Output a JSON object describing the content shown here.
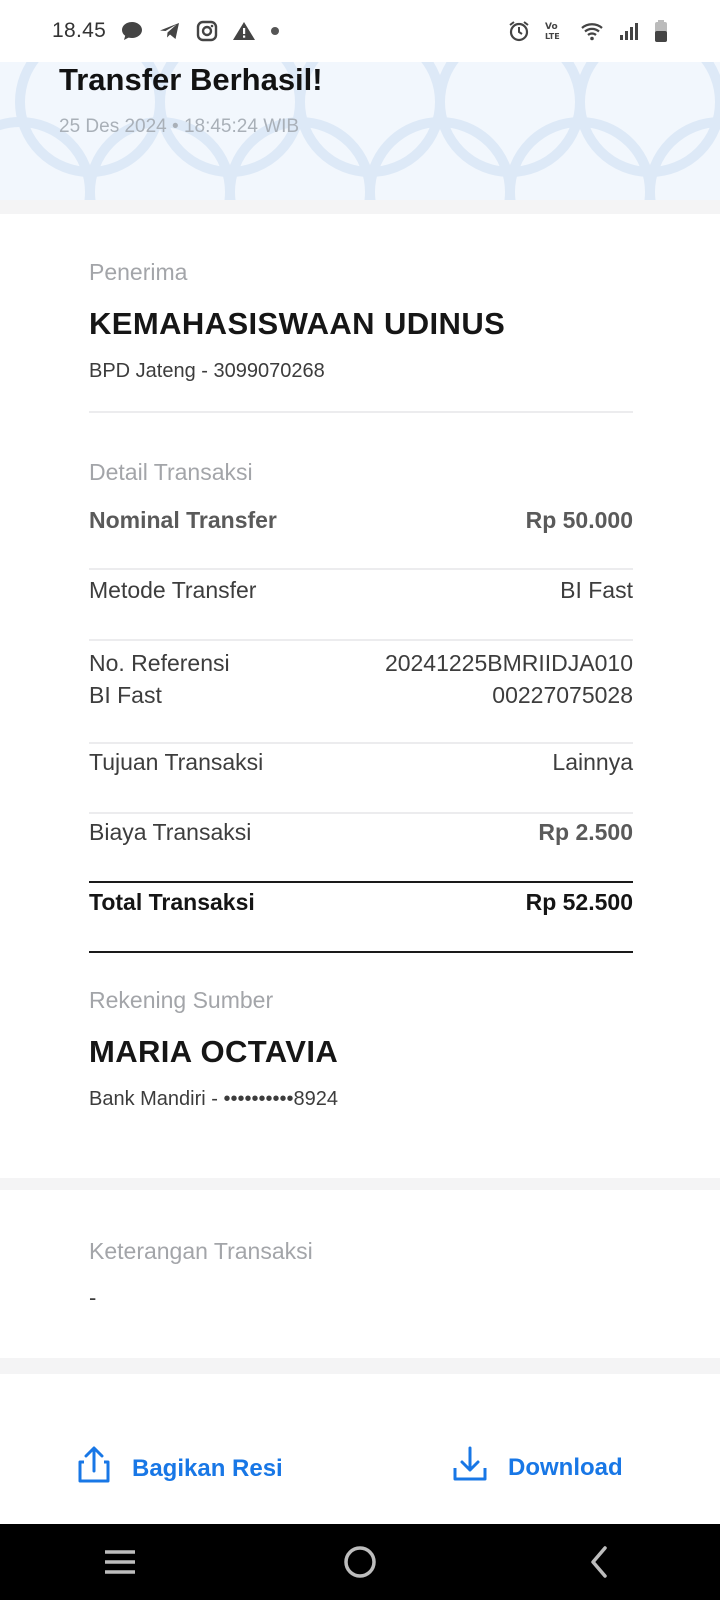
{
  "status_bar": {
    "time": "18.45",
    "left_icons": [
      "chat-bubble-icon",
      "telegram-icon",
      "instagram-icon",
      "warning-icon",
      "dot-icon"
    ],
    "right_icons": [
      "alarm-icon",
      "volte-icon",
      "wifi-icon",
      "signal-icon",
      "battery-icon"
    ],
    "volte_text": "Vo LTE"
  },
  "header": {
    "title": "Transfer Berhasil!",
    "date": "25 Des 2024 • 18:45:24 WIB"
  },
  "recipient": {
    "label": "Penerima",
    "name": "KEMAHASISWAAN UDINUS",
    "account": "BPD Jateng - 3099070268"
  },
  "details": {
    "section_label": "Detail Transaksi",
    "nominal": {
      "label": "Nominal Transfer",
      "value": "Rp 50.000"
    },
    "method": {
      "label": "Metode Transfer",
      "value": "BI Fast"
    },
    "reference": {
      "label_line1": "No. Referensi",
      "label_line2": "BI Fast",
      "value_line1": "20241225BMRIIDJA010",
      "value_line2": "00227075028"
    },
    "purpose": {
      "label": "Tujuan Transaksi",
      "value": "Lainnya"
    },
    "fee": {
      "label": "Biaya Transaksi",
      "value": "Rp 2.500"
    },
    "total": {
      "label": "Total Transaksi",
      "value": "Rp 52.500"
    }
  },
  "source": {
    "label": "Rekening Sumber",
    "name": "MARIA OCTAVIA",
    "account": "Bank Mandiri - ••••••••••8924"
  },
  "notes": {
    "label": "Keterangan Transaksi",
    "value": "-"
  },
  "actions": {
    "share_label": "Bagikan Resi",
    "download_label": "Download",
    "accent_color": "#1877e6"
  },
  "nav_bar": {
    "buttons": [
      "recents-icon",
      "home-icon",
      "back-icon"
    ]
  }
}
